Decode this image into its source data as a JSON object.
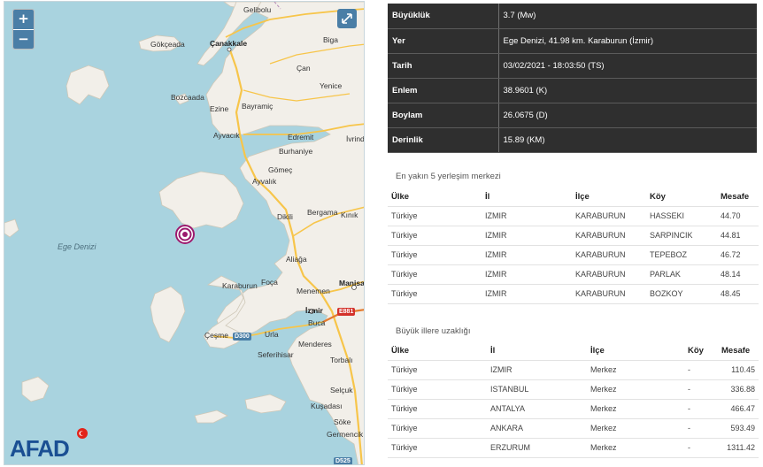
{
  "map": {
    "zoom_in": "+",
    "zoom_out": "−",
    "sea_label": "Ege Denizi",
    "logo_text": "AFAD",
    "places": [
      "Gelibolu",
      "Gökçeada",
      "Çanakkale",
      "Biga",
      "Çan",
      "Yenice",
      "Bozcaada",
      "Ezine",
      "Bayramiç",
      "Ayvacık",
      "Edremit",
      "İvrind",
      "Burhaniye",
      "Gömeç",
      "Ayvalık",
      "Dikili",
      "Bergama",
      "Kınık",
      "Aliağa",
      "Foça",
      "Karaburun",
      "Menemen",
      "Manisa",
      "İzmir",
      "Buca",
      "Çeşme",
      "Urla",
      "Seferihisar",
      "Menderes",
      "Torbalı",
      "Selçuk",
      "Kuşadası",
      "Söke",
      "Germencik"
    ],
    "roads": [
      "E881",
      "D300",
      "D525"
    ]
  },
  "quake": {
    "rows": [
      {
        "label": "Büyüklük",
        "value": "3.7 (Mw)"
      },
      {
        "label": "Yer",
        "value": "Ege Denizi, 41.98 km. Karaburun (İzmir)"
      },
      {
        "label": "Tarih",
        "value": "03/02/2021 - 18:03:50 (TS)"
      },
      {
        "label": "Enlem",
        "value": "38.9601 (K)"
      },
      {
        "label": "Boylam",
        "value": "26.0675 (D)"
      },
      {
        "label": "Derinlik",
        "value": "15.89 (KM)"
      }
    ]
  },
  "nearest": {
    "caption": "En yakın 5 yerleşim merkezi",
    "headers": [
      "Ülke",
      "İl",
      "İlçe",
      "Köy",
      "Mesafe"
    ],
    "rows": [
      [
        "Türkiye",
        "IZMIR",
        "KARABURUN",
        "HASSEKI",
        "44.70"
      ],
      [
        "Türkiye",
        "IZMIR",
        "KARABURUN",
        "SARPINCIK",
        "44.81"
      ],
      [
        "Türkiye",
        "IZMIR",
        "KARABURUN",
        "TEPEBOZ",
        "46.72"
      ],
      [
        "Türkiye",
        "IZMIR",
        "KARABURUN",
        "PARLAK",
        "48.14"
      ],
      [
        "Türkiye",
        "IZMIR",
        "KARABURUN",
        "BOZKOY",
        "48.45"
      ]
    ]
  },
  "cities": {
    "caption": "Büyük illere uzaklığı",
    "headers": [
      "Ülke",
      "İl",
      "İlçe",
      "Köy",
      "Mesafe"
    ],
    "rows": [
      [
        "Türkiye",
        "IZMIR",
        "Merkez",
        "-",
        "110.45"
      ],
      [
        "Türkiye",
        "ISTANBUL",
        "Merkez",
        "-",
        "336.88"
      ],
      [
        "Türkiye",
        "ANTALYA",
        "Merkez",
        "-",
        "466.47"
      ],
      [
        "Türkiye",
        "ANKARA",
        "Merkez",
        "-",
        "593.49"
      ],
      [
        "Türkiye",
        "ERZURUM",
        "Merkez",
        "-",
        "1311.42"
      ]
    ]
  },
  "colors": {
    "epicenter": "#9b1a6e",
    "table_dark": "#2f2f2f",
    "sea": "#a9d3df",
    "land": "#f2efe9",
    "road": "#f7c54a",
    "afad_blue": "#1a4f93",
    "afad_red": "#e2231a"
  }
}
